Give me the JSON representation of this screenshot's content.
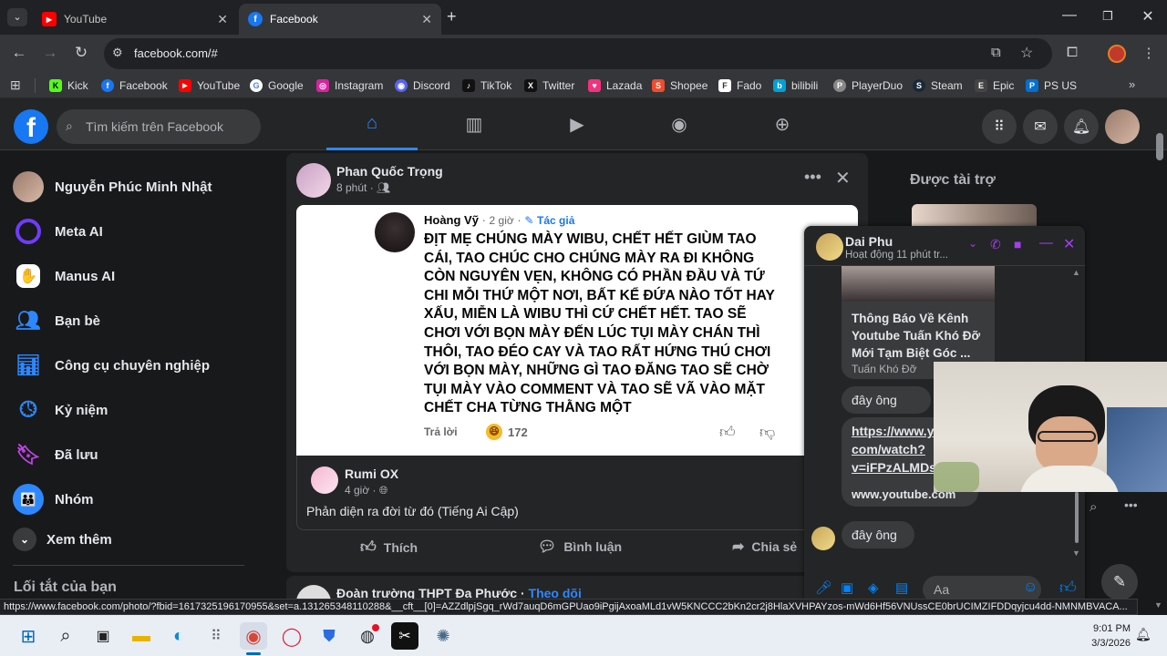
{
  "browser": {
    "tabs": [
      {
        "title": "YouTube",
        "color": "#ff0000",
        "active": false
      },
      {
        "title": "Facebook",
        "color": "#1877f2",
        "active": true
      }
    ],
    "url": "facebook.com/#",
    "bookmarks": [
      {
        "label": "Kick",
        "color": "#53fc18",
        "glyph": "K"
      },
      {
        "label": "Facebook",
        "color": "#1877f2",
        "glyph": "f"
      },
      {
        "label": "YouTube",
        "color": "#ff0000",
        "glyph": "▶"
      },
      {
        "label": "Google",
        "color": "#4285f4",
        "glyph": "G"
      },
      {
        "label": "Instagram",
        "color": "#d6249f",
        "glyph": "◎"
      },
      {
        "label": "Discord",
        "color": "#5865f2",
        "glyph": "◉"
      },
      {
        "label": "TikTok",
        "color": "#111111",
        "glyph": "♪"
      },
      {
        "label": "Twitter",
        "color": "#111111",
        "glyph": "X"
      },
      {
        "label": "Lazada",
        "color": "#f5317f",
        "glyph": "♥"
      },
      {
        "label": "Shopee",
        "color": "#ee4d2d",
        "glyph": "S"
      },
      {
        "label": "Fado",
        "color": "#ffffff",
        "glyph": "F"
      },
      {
        "label": "bilibili",
        "color": "#00a1d6",
        "glyph": "b"
      },
      {
        "label": "PlayerDuo",
        "color": "#888888",
        "glyph": "P"
      },
      {
        "label": "Steam",
        "color": "#1b2838",
        "glyph": "S"
      },
      {
        "label": "Epic",
        "color": "#444444",
        "glyph": "E"
      },
      {
        "label": "PS US",
        "color": "#0070d1",
        "glyph": "P"
      }
    ]
  },
  "fb": {
    "search_placeholder": "Tìm kiếm trên Facebook",
    "sidebar": [
      {
        "label": "Nguyễn Phúc Minh Nhật",
        "icon": "profile-avatar"
      },
      {
        "label": "Meta AI",
        "icon": "meta-ai-icon"
      },
      {
        "label": "Manus AI",
        "icon": "manus-ai-icon"
      },
      {
        "label": "Bạn bè",
        "icon": "friends-icon"
      },
      {
        "label": "Công cụ chuyên nghiệp",
        "icon": "professional-tools-icon"
      },
      {
        "label": "Kỷ niệm",
        "icon": "memories-icon"
      },
      {
        "label": "Đã lưu",
        "icon": "saved-icon"
      },
      {
        "label": "Nhóm",
        "icon": "groups-icon"
      }
    ],
    "see_more": "Xem thêm",
    "shortcuts_title": "Lối tắt của bạn",
    "sponsored": "Được tài trợ"
  },
  "post": {
    "author": "Phan Quốc Trọng",
    "time": "8 phút",
    "quoted": {
      "author": "Hoàng Vỹ",
      "time": "2 giờ",
      "badge": "Tác giả",
      "text": "ĐỊT MẸ CHÚNG MÀY WIBU, CHẾT HẾT GIÙM TAO CÁI, TAO CHÚC CHO CHÚNG MÀY RA ĐI KHÔNG CÒN NGUYÊN VẸN, KHÔNG CÓ PHẦN ĐẦU VÀ TỨ CHI MỖI THỨ MỘT NƠI, BẤT KỂ ĐỨA NÀO TỐT HAY XẤU, MIỄN LÀ WIBU THÌ CỨ CHẾT HẾT. TAO SẼ CHƠI VỚI BỌN MÀY ĐẾN LÚC TỤI MÀY CHÁN THÌ THÔI, TAO ĐÉO CAY VÀ TAO RẤT HỨNG THÚ CHƠI VỚI BỌN MÀY, NHỮNG GÌ TAO ĐĂNG TAO SẼ CHỜ TỤI MÀY VÀO COMMENT VÀ TAO SẼ VÃ VÀO MẶT CHẾT CHA TỪNG THẰNG MỘT",
      "reply": "Trả lời",
      "reactions": "172"
    },
    "shared": {
      "author": "Rumi OX",
      "time": "4 giờ",
      "text": "Phản diện ra đời từ đó (Tiếng Ai Cập)"
    },
    "actions": [
      "Thích",
      "Bình luận",
      "Chia sẻ"
    ]
  },
  "next_post": {
    "author": "Đoàn trường THPT Đa Phước",
    "follow": "Theo dõi"
  },
  "chat": {
    "name": "Dai Phu",
    "status": "Hoạt động 11 phút tr...",
    "link_title": "Thông Báo Về Kênh Youtube Tuấn Khó Đỡ Mới Tạm Biệt Góc ...",
    "link_source": "Tuấn Khó Đỡ",
    "msg1": "đây ông",
    "url_msg_line1": "https://www.y",
    "url_msg_line2": "com/watch?",
    "url_msg_line3": "v=iFPzALMDs",
    "url_domain": "www.youtube.com",
    "msg2": "đây ông",
    "input_placeholder": "Aa"
  },
  "status_url": "https://www.facebook.com/photo/?fbid=1617325196170955&set=a.131265348110288&__cft__[0]=AZZdlpjSgq_rWd7auqD6mGPUao9iPgijAxoaMLd1vW5KNCCC2bKn2cr2j8HlaXVHPAYzos-mWd6Hf56VNUssCE0brUCIMZIFDDqyjcu4dd-NMNMBVACA...",
  "clock": {
    "time": "9:01 PM",
    "date": "3/3/2026"
  }
}
